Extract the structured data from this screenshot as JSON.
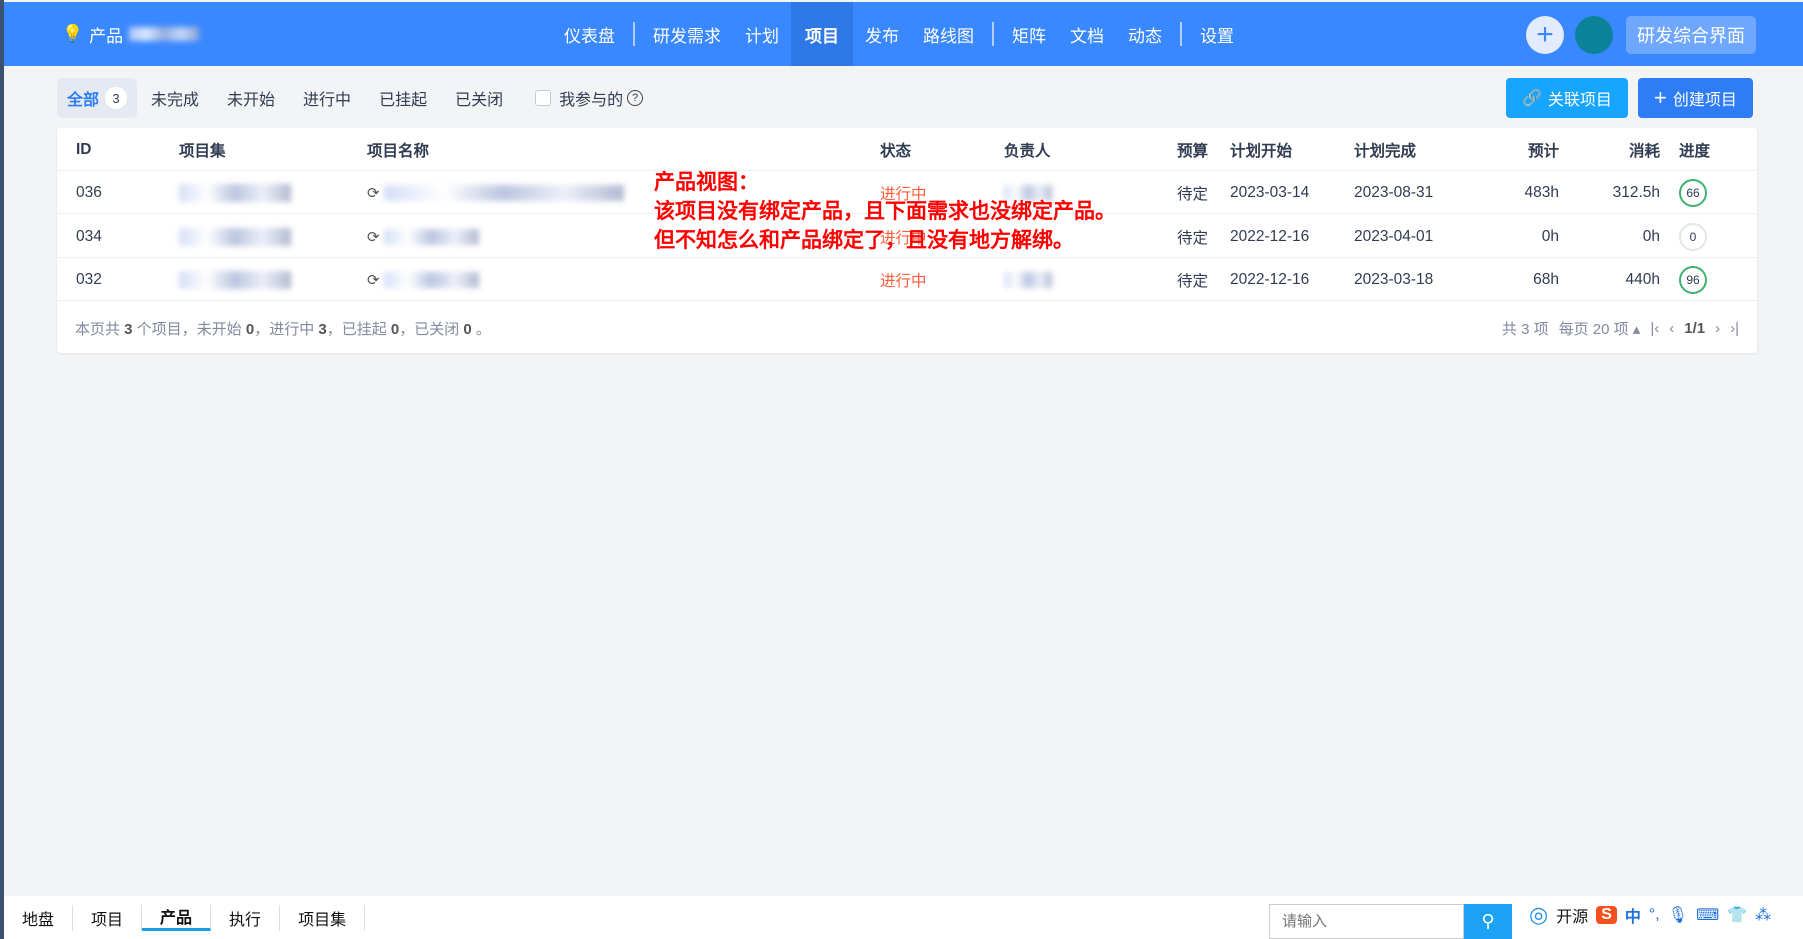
{
  "header": {
    "product_label": "产品",
    "nav": [
      "仪表盘",
      "研发需求",
      "计划",
      "项目",
      "发布",
      "路线图",
      "矩阵",
      "文档",
      "动态",
      "设置"
    ],
    "active_nav": "项目",
    "workspace": "研发综合界面"
  },
  "filters": {
    "items": [
      "全部",
      "未完成",
      "未开始",
      "进行中",
      "已挂起",
      "已关闭"
    ],
    "all_count": "3",
    "mine": "我参与的"
  },
  "buttons": {
    "link": "关联项目",
    "create": "创建项目"
  },
  "table": {
    "headers": [
      "ID",
      "项目集",
      "项目名称",
      "状态",
      "负责人",
      "预算",
      "计划开始",
      "计划完成",
      "预计",
      "消耗",
      "进度"
    ],
    "rows": [
      {
        "id": "036",
        "status": "进行中",
        "budget": "待定",
        "start": "2023-03-14",
        "end": "2023-08-31",
        "est": "483h",
        "used": "312.5h",
        "progress": "66"
      },
      {
        "id": "034",
        "status": "进行中",
        "budget": "待定",
        "start": "2022-12-16",
        "end": "2023-04-01",
        "est": "0h",
        "used": "0h",
        "progress": "0"
      },
      {
        "id": "032",
        "status": "进行中",
        "budget": "待定",
        "start": "2022-12-16",
        "end": "2023-03-18",
        "est": "68h",
        "used": "440h",
        "progress": "96"
      }
    ]
  },
  "summary": {
    "p1": "本页共 ",
    "total": "3",
    "p2": " 个项目，未开始 ",
    "notstarted": "0",
    "p3": "，进行中 ",
    "doing": "3",
    "p4": "，已挂起 ",
    "suspended": "0",
    "p5": "，已关闭 ",
    "closed": "0",
    "p6": " 。"
  },
  "pager": {
    "total": "共 3 项",
    "per_page": "每页 20 项",
    "page": "1/1"
  },
  "annotation": [
    "产品视图：",
    "该项目没有绑定产品，且下面需求也没绑定产品。",
    "但不知怎么和产品绑定了，且没有地方解绑。"
  ],
  "bottom": {
    "tabs": [
      "地盘",
      "项目",
      "产品",
      "执行",
      "项目集"
    ],
    "active": "产品",
    "search_placeholder": "请输入",
    "tray": [
      "开源",
      "中",
      "°,"
    ]
  }
}
